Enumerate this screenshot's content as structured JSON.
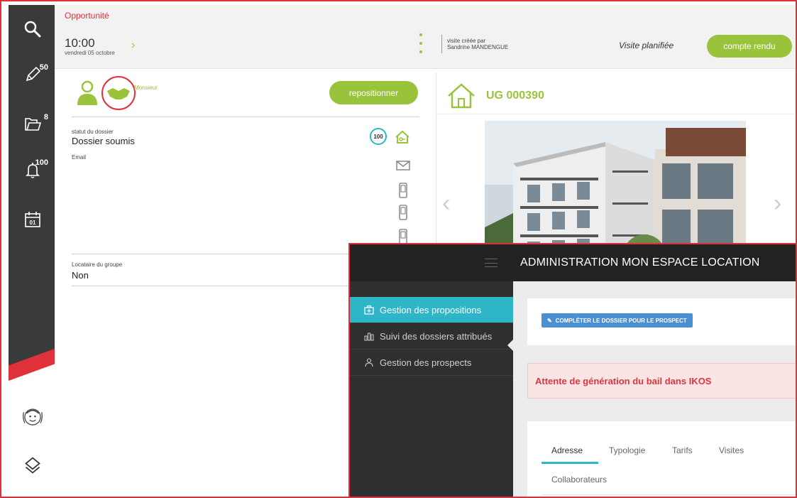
{
  "sidebar": {
    "badges": {
      "notes": "50",
      "folders": "8",
      "alerts": "100"
    },
    "calendar_day": "01"
  },
  "header": {
    "title": "Opportunité",
    "time": "10:00",
    "date": "vendredi 05 octobre",
    "created_by_label": "visite créée par",
    "created_by_name": "Sandrine MANDENGUE",
    "status": "Visite planifiée",
    "report_button": "compte rendu"
  },
  "client": {
    "title_partial": "Monsieur",
    "reposition_button": "repositionner",
    "status_label": "statut du dossier",
    "status_value": "Dossier soumis",
    "score": "100",
    "email_label": "Email",
    "group_label": "Locataire du groupe",
    "group_value": "Non"
  },
  "unit": {
    "code": "UG 000390"
  },
  "admin": {
    "title": "ADMINISTRATION MON ESPACE LOCATION",
    "nav": [
      {
        "label": "Gestion des propositions"
      },
      {
        "label": "Suivi des dossiers attribués"
      },
      {
        "label": "Gestion des prospects"
      }
    ],
    "complete_button": "COMPLÉTER LE DOSSIER POUR LE PROSPECT",
    "alert": "Attente de génération du bail dans IKOS",
    "tabs": [
      "Adresse",
      "Typologie",
      "Tarifs",
      "Visites",
      "Collaborateurs"
    ]
  },
  "colors": {
    "accent_green": "#9ac33c",
    "accent_red": "#e0303a",
    "accent_cyan": "#2fb5c8",
    "button_blue": "#4a8fd1"
  }
}
